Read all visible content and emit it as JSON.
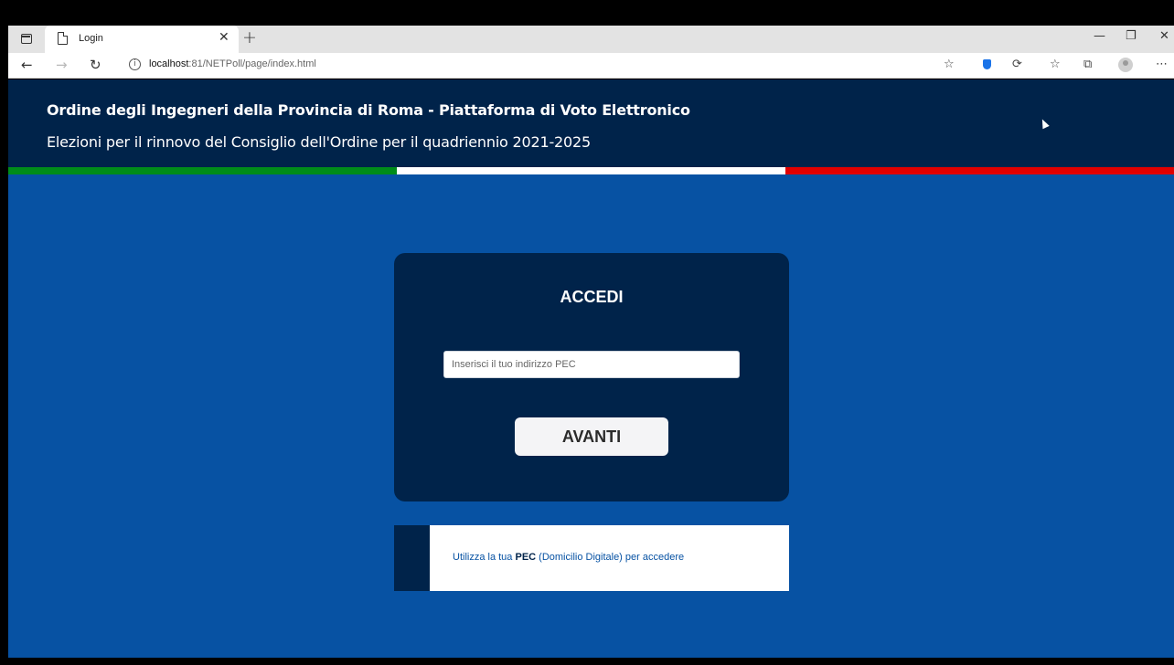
{
  "browser": {
    "tab": {
      "title": "Login"
    },
    "url": {
      "host": "localhost",
      "rest": ":81/NETPoll/page/index.html"
    }
  },
  "header": {
    "title": "Ordine degli Ingegneri della Provincia di Roma - Piattaforma di Voto Elettronico",
    "subtitle": "Elezioni per il rinnovo del Consiglio dell'Ordine per il quadriennio 2021-2025"
  },
  "flag_colors": [
    "#008c1a",
    "#ffffff",
    "#e10000"
  ],
  "login": {
    "title": "ACCEDI",
    "pec_placeholder": "Inserisci il tuo indirizzo PEC",
    "pec_value": "",
    "submit_label": "AVANTI"
  },
  "info": {
    "prefix": "Utilizza la tua ",
    "strong": "PEC",
    "suffix": " (Domicilio Digitale) per accedere"
  },
  "colors": {
    "page_bg": "#0752a3",
    "header_bg": "#00234a",
    "card_bg": "#00234a"
  }
}
